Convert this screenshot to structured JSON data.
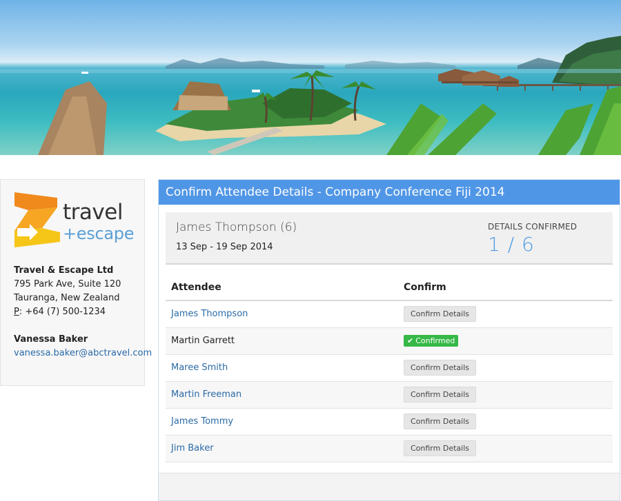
{
  "company": {
    "logo_word1": "travel",
    "logo_word2": "+escape",
    "name": "Travel & Escape Ltd",
    "address_line1": "795 Park Ave, Suite 120",
    "address_line2": "Tauranga, New Zealand",
    "phone_label": "P",
    "phone": ": +64 (7) 500-1234",
    "contact_name": "Vanessa Baker",
    "contact_email": "vanessa.baker@abctravel.com"
  },
  "panel": {
    "title": "Confirm Attendee Details - Company Conference Fiji 2014",
    "booking_name": "James Thompson (6)",
    "dates": "13 Sep - 19 Sep 2014",
    "confirmed_label": "DETAILS CONFIRMED",
    "confirmed_count": "1 / 6"
  },
  "table": {
    "headers": [
      "Attendee",
      "Confirm"
    ],
    "rows": [
      {
        "name": "James Thompson",
        "status": "Confirm Details"
      },
      {
        "name": "Martin Garrett",
        "status": "Confirmed"
      },
      {
        "name": "Maree Smith",
        "status": "Confirm Details"
      },
      {
        "name": "Martin Freeman",
        "status": "Confirm Details"
      },
      {
        "name": "James Tommy",
        "status": "Confirm Details"
      },
      {
        "name": "Jim Baker",
        "status": "Confirm Details"
      }
    ]
  },
  "colors": {
    "header_blue": "#5096e6",
    "link_blue": "#2b6aa5",
    "confirmed_green": "#35b847",
    "count_blue": "#4c9be3",
    "logo_orange": "#f08a1c",
    "logo_yellow": "#f5c518"
  },
  "icons": {
    "confirmed_check": "check-icon"
  }
}
